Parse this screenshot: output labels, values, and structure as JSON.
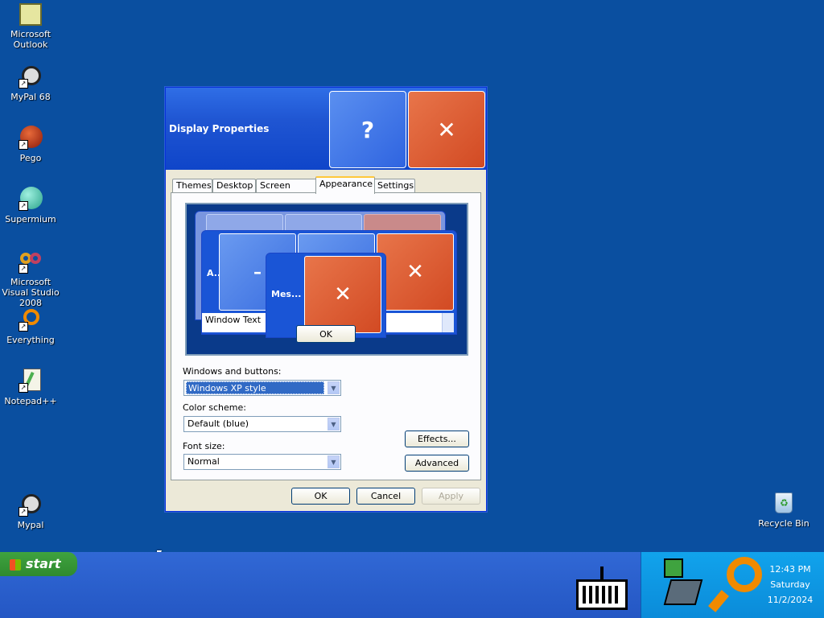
{
  "desktop": {
    "icons": [
      {
        "label": "Microsoft Outlook",
        "icon": "outlook-icon"
      },
      {
        "label": "MyPal 68",
        "icon": "raccoon-icon"
      },
      {
        "label": "Pego",
        "icon": "pego-icon"
      },
      {
        "label": "Supermium",
        "icon": "supermium-icon"
      },
      {
        "label": "Microsoft Visual Studio 2008",
        "icon": "visual-studio-icon"
      },
      {
        "label": "Everything",
        "icon": "everything-icon"
      },
      {
        "label": "Notepad++",
        "icon": "notepad-icon"
      },
      {
        "label": "Mypal",
        "icon": "raccoon-icon"
      },
      {
        "label": "Recycle Bin",
        "icon": "recycle-bin-icon"
      }
    ]
  },
  "window": {
    "title": "Display Properties",
    "help_glyph": "?",
    "close_glyph": "✕",
    "tabs": [
      "Themes",
      "Desktop",
      "Screen Saver",
      "Appearance",
      "Settings"
    ],
    "active_tab": "Appearance",
    "preview": {
      "active_title": "A..",
      "message_title": "Mes...",
      "minimize_glyph": "–",
      "close_glyph": "✕",
      "window_text": "Window Text",
      "ok": "OK"
    },
    "windows_buttons_label": "Windows and buttons:",
    "windows_buttons_value": "Windows XP style",
    "color_scheme_label": "Color scheme:",
    "color_scheme_value": "Default (blue)",
    "font_size_label": "Font size:",
    "font_size_value": "Normal",
    "effects_button": "Effects...",
    "advanced_button": "Advanced",
    "ok_button": "OK",
    "cancel_button": "Cancel",
    "apply_button": "Apply"
  },
  "taskbar": {
    "start_label": "start",
    "clock_time": "12:43 PM",
    "clock_day": "Saturday",
    "clock_date": "11/2/2024"
  }
}
